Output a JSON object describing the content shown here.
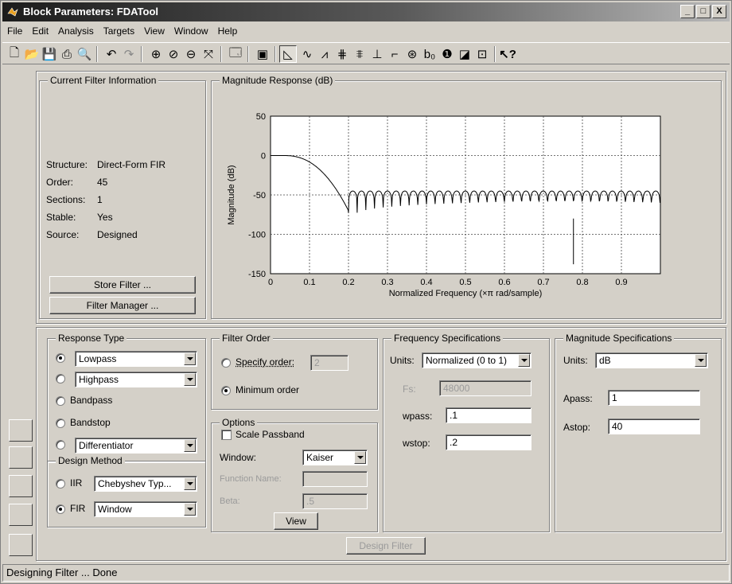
{
  "window": {
    "title": "Block Parameters: FDATool"
  },
  "titlebar_buttons": [
    "_",
    "□",
    "X"
  ],
  "menu": [
    "File",
    "Edit",
    "Analysis",
    "Targets",
    "View",
    "Window",
    "Help"
  ],
  "current_filter": {
    "title": "Current Filter Information",
    "rows": [
      {
        "label": "Structure:",
        "value": "Direct-Form FIR"
      },
      {
        "label": "Order:",
        "value": "45"
      },
      {
        "label": "Sections:",
        "value": "1"
      },
      {
        "label": "Stable:",
        "value": "Yes"
      },
      {
        "label": "Source:",
        "value": "Designed"
      }
    ],
    "store_button": "Store Filter ...",
    "manager_button": "Filter Manager ..."
  },
  "plot": {
    "title": "Magnitude Response (dB)",
    "xlabel": "Normalized Frequency (×π rad/sample)",
    "ylabel": "Magnitude (dB)",
    "xticks": [
      "0",
      "0.1",
      "0.2",
      "0.3",
      "0.4",
      "0.5",
      "0.6",
      "0.7",
      "0.8",
      "0.9"
    ],
    "yticks": [
      "50",
      "0",
      "-50",
      "-100",
      "-150"
    ]
  },
  "chart_data": {
    "type": "line",
    "title": "Magnitude Response (dB)",
    "xlabel": "Normalized Frequency (×π rad/sample)",
    "ylabel": "Magnitude (dB)",
    "xlim": [
      0,
      1
    ],
    "ylim": [
      -150,
      50
    ],
    "grid": true,
    "passband_edge": 0.1,
    "stopband_edge": 0.2,
    "passband_level": 0,
    "stopband_sidelobe_level": -45,
    "deepest_null": -138
  },
  "response_type": {
    "title": "Response Type",
    "options": [
      {
        "label": "Lowpass",
        "selected": true,
        "dropdown": true
      },
      {
        "label": "Highpass",
        "selected": false,
        "dropdown": true
      },
      {
        "label": "Bandpass",
        "selected": false,
        "dropdown": false
      },
      {
        "label": "Bandstop",
        "selected": false,
        "dropdown": false
      },
      {
        "label": "Differentiator",
        "selected": false,
        "dropdown": true
      }
    ]
  },
  "design_method": {
    "title": "Design Method",
    "iir_label": "IIR",
    "iir_value": "Chebyshev Typ...",
    "fir_label": "FIR",
    "fir_value": "Window"
  },
  "filter_order": {
    "title": "Filter Order",
    "specify_label": "Specify order:",
    "specify_value": "2",
    "minimum_label": "Minimum order"
  },
  "options": {
    "title": "Options",
    "scale_label": "Scale Passband",
    "window_label": "Window:",
    "window_value": "Kaiser",
    "function_label": "Function Name:",
    "beta_label": "Beta:",
    "beta_value": ".5",
    "view_button": "View"
  },
  "freq_spec": {
    "title": "Frequency Specifications",
    "units_label": "Units:",
    "units_value": "Normalized (0 to 1)",
    "fs_label": "Fs:",
    "fs_value": "48000",
    "wpass_label": "wpass:",
    "wpass_value": ".1",
    "wstop_label": "wstop:",
    "wstop_value": ".2"
  },
  "mag_spec": {
    "title": "Magnitude Specifications",
    "units_label": "Units:",
    "units_value": "dB",
    "apass_label": "Apass:",
    "apass_value": "1",
    "astop_label": "Astop:",
    "astop_value": "40"
  },
  "design_button": "Design Filter",
  "status": "Designing Filter ... Done"
}
